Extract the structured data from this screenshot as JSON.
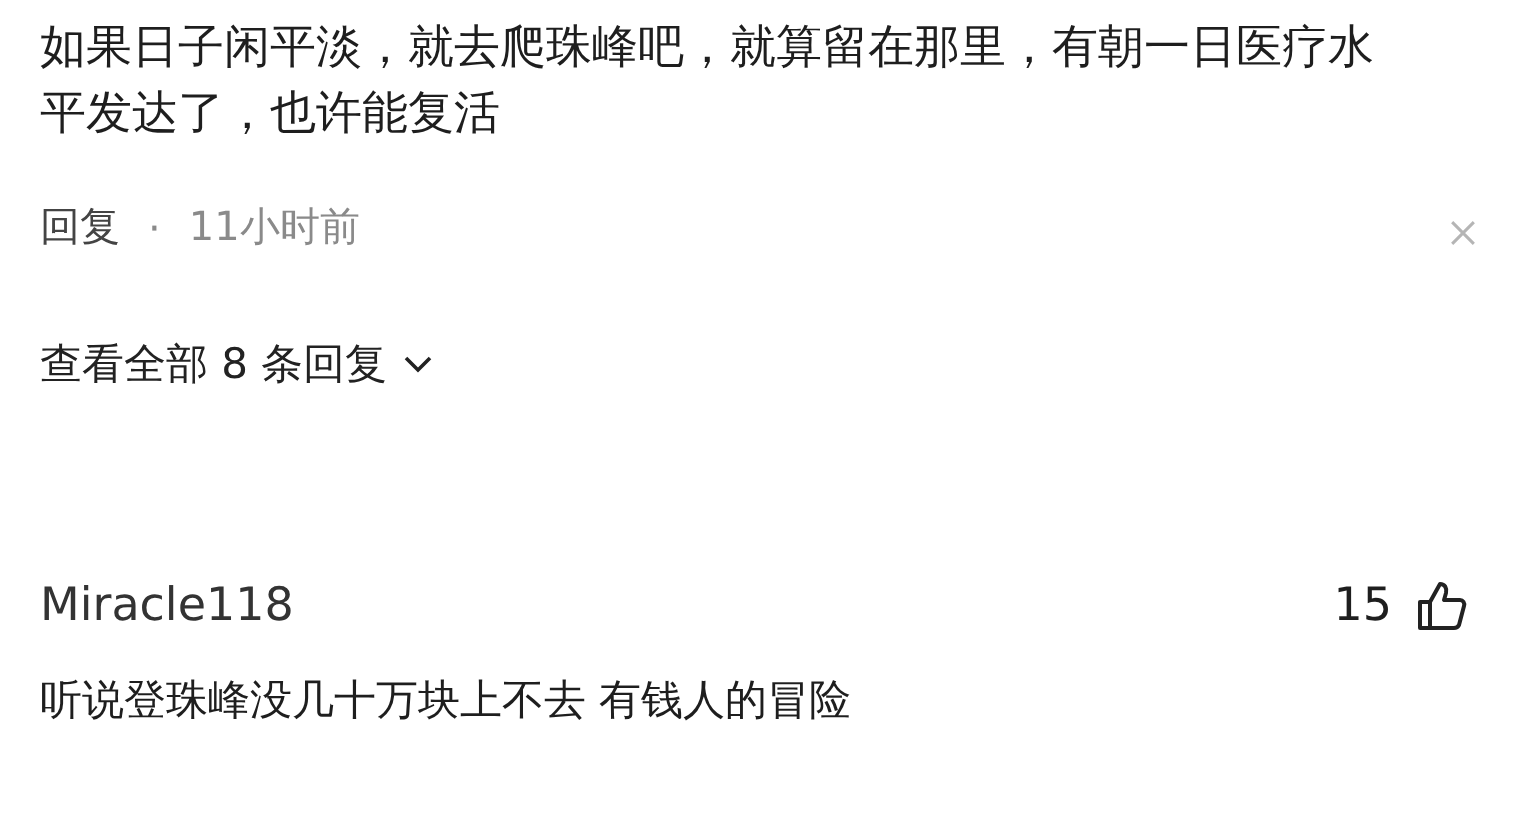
{
  "first_comment": {
    "text": "如果日子闲平淡，就去爬珠峰吧，就算留在那里，有朝一日医疗水平发达了，也许能复活",
    "reply_label": "回复",
    "separator": "·",
    "time": "11小时前",
    "view_replies": "查看全部 8 条回复"
  },
  "second_comment": {
    "author": "Miracle118",
    "likes": "15",
    "text": "听说登珠峰没几十万块上不去 有钱人的冒险"
  }
}
